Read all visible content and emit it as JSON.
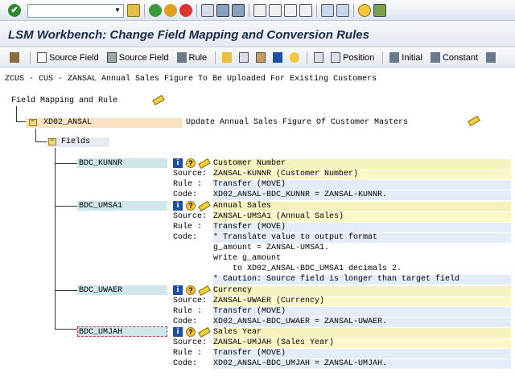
{
  "system_toolbar": {
    "ok_icon": "checkmark-icon",
    "command_value": "",
    "icons": [
      "save-icon",
      "back-icon",
      "exit-icon",
      "cancel-icon",
      "print-icon",
      "find-icon",
      "find-next-icon",
      "first-page-icon",
      "previous-page-icon",
      "next-page-icon",
      "last-page-icon",
      "new-session-icon",
      "shortcut-icon",
      "help-icon",
      "customize-icon"
    ]
  },
  "title": "LSM Workbench: Change Field Mapping and Conversion Rules",
  "app_toolbar": {
    "buttons": [
      {
        "label": "",
        "icon": "edit-icon"
      },
      {
        "label": "Source Field",
        "icon": "document-icon"
      },
      {
        "label": "Source Field",
        "icon": "trash-icon"
      },
      {
        "label": "Rule",
        "icon": "rule-icon"
      },
      {
        "label": "",
        "icon": "pencil-icon"
      },
      {
        "label": "",
        "icon": "copy-icon"
      },
      {
        "label": "",
        "icon": "paste-icon"
      },
      {
        "label": "",
        "icon": "info-icon"
      },
      {
        "label": "",
        "icon": "help-icon"
      },
      {
        "label": "",
        "icon": "position-icon"
      },
      {
        "label": "Position",
        "icon": "position-list-icon"
      },
      {
        "label": "Initial",
        "icon": "rule-icon"
      },
      {
        "label": "Constant",
        "icon": "rule-icon"
      }
    ]
  },
  "content": {
    "header": "ZCUS - CUS - ZANSAL Annual Sales Figure To Be Uploaded For Existing Customers",
    "tree_label": "Field Mapping and Rule",
    "structure": {
      "name": "XD02_ANSAL",
      "description": "Update Annual Sales Figure Of Customer Masters"
    },
    "fields_label": "Fields",
    "labels": {
      "source": "Source:",
      "rule": "Rule :",
      "code": "Code:"
    },
    "fields": [
      {
        "name": "BDC_KUNNR",
        "description": "Customer Number",
        "source": "ZANSAL-KUNNR (Customer Number)",
        "rule": "Transfer (MOVE)",
        "code": [
          "XD02_ANSAL-BDC_KUNNR = ZANSAL-KUNNR."
        ]
      },
      {
        "name": "BDC_UMSA1",
        "description": "Annual Sales",
        "source": "ZANSAL-UMSA1 (Annual Sales)",
        "rule": "Transfer (MOVE)",
        "code": [
          "* Translate value to output format",
          "g_amount = ZANSAL-UMSA1.",
          "write g_amount",
          "    to XD02_ANSAL-BDC_UMSA1 decimals 2.",
          "* Caution: Source field is longer than target field"
        ]
      },
      {
        "name": "BDC_UWAER",
        "description": "Currency",
        "source": "ZANSAL-UWAER (Currency)",
        "rule": "Transfer (MOVE)",
        "code": [
          "XD02_ANSAL-BDC_UWAER = ZANSAL-UWAER."
        ]
      },
      {
        "name": "BDC_UMJAH",
        "description": "Sales Year",
        "source": "ZANSAL-UMJAH (Sales Year)",
        "rule": "Transfer (MOVE)",
        "code": [
          "XD02_ANSAL-BDC_UMJAH = ZANSAL-UMJAH."
        ]
      }
    ]
  }
}
